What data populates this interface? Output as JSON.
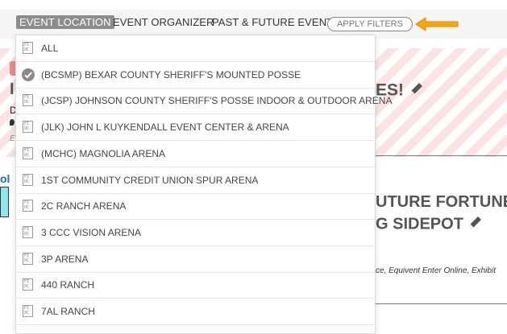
{
  "filter_bar": {
    "tabs": [
      {
        "label": "EVENT LOCATION",
        "active": true
      },
      {
        "label": "EVENT ORGANIZER",
        "active": false
      },
      {
        "label": "PAST & FUTURE EVENTS",
        "active": false
      }
    ],
    "apply_label": "APPLY FILTERS",
    "arrow_color": "#f0a400"
  },
  "background": {
    "heading1": "ES!",
    "heading2_line1": "UTURE FORTUNE",
    "heading2_line2": "G SIDEPOT",
    "small_text": "ce,  Equivent Enter Online,  Exhibit",
    "frag_d": "D",
    "frag_e": "E",
    "frag_ol": "ol"
  },
  "dropdown": {
    "items": [
      {
        "label": "ALL",
        "selected": false,
        "icon": "filter-file-icon"
      },
      {
        "label": "(BCSMP) BEXAR COUNTY SHERIFF'S MOUNTED POSSE",
        "selected": true,
        "icon": "checkmark-icon"
      },
      {
        "label": "(JCSP) JOHNSON COUNTY SHERIFF'S POSSE INDOOR & OUTDOOR ARENA",
        "selected": false,
        "icon": "filter-file-icon"
      },
      {
        "label": "(JLK) JOHN L KUYKENDALL EVENT CENTER & ARENA",
        "selected": false,
        "icon": "filter-file-icon"
      },
      {
        "label": "(MCHC) MAGNOLIA ARENA",
        "selected": false,
        "icon": "filter-file-icon"
      },
      {
        "label": "1ST COMMUNITY CREDIT UNION SPUR ARENA",
        "selected": false,
        "icon": "filter-file-icon"
      },
      {
        "label": "2C RANCH ARENA",
        "selected": false,
        "icon": "filter-file-icon"
      },
      {
        "label": "3 CCC VISION ARENA",
        "selected": false,
        "icon": "filter-file-icon"
      },
      {
        "label": "3P ARENA",
        "selected": false,
        "icon": "filter-file-icon"
      },
      {
        "label": "440 RANCH",
        "selected": false,
        "icon": "filter-file-icon"
      },
      {
        "label": "7AL RANCH",
        "selected": false,
        "icon": "filter-file-icon"
      }
    ],
    "icon_glyph_top": "FI",
    "icon_glyph_bottom": "OC"
  }
}
